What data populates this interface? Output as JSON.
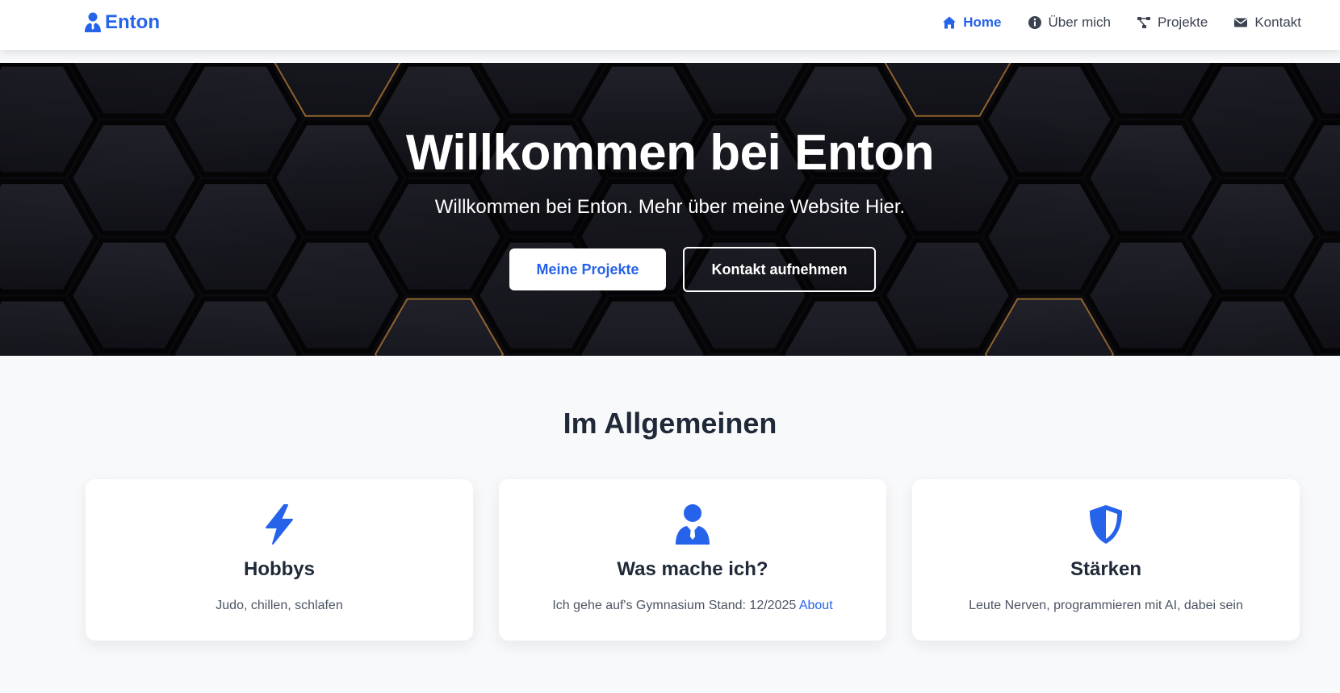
{
  "nav": {
    "brand": "Enton",
    "brand_icon": "user-tie-icon",
    "links": [
      {
        "label": "Home",
        "icon": "home-icon",
        "active": true
      },
      {
        "label": "Über mich",
        "icon": "info-circle-icon",
        "active": false
      },
      {
        "label": "Projekte",
        "icon": "project-diagram-icon",
        "active": false
      },
      {
        "label": "Kontakt",
        "icon": "envelope-icon",
        "active": false
      }
    ]
  },
  "hero": {
    "title": "Willkommen bei Enton",
    "subtitle": "Willkommen bei Enton. Mehr über meine Website Hier.",
    "primary_button": "Meine Projekte",
    "secondary_button": "Kontakt aufnehmen"
  },
  "section": {
    "title": "Im Allgemeinen",
    "cards": [
      {
        "icon": "bolt-icon",
        "title": "Hobbys",
        "text": "Judo, chillen, schlafen"
      },
      {
        "icon": "user-tie-icon",
        "title": "Was mache ich?",
        "text": "Ich gehe auf's Gymnasium Stand: 12/2025",
        "link": "About"
      },
      {
        "icon": "shield-icon",
        "title": "Stärken",
        "text": "Leute Nerven, programmieren mit AI, dabei sein"
      }
    ]
  },
  "colors": {
    "accent": "#2563eb",
    "hero_background": "#15151d",
    "hex_glow": "#c98a3a",
    "page_background": "#f8f9fb"
  }
}
